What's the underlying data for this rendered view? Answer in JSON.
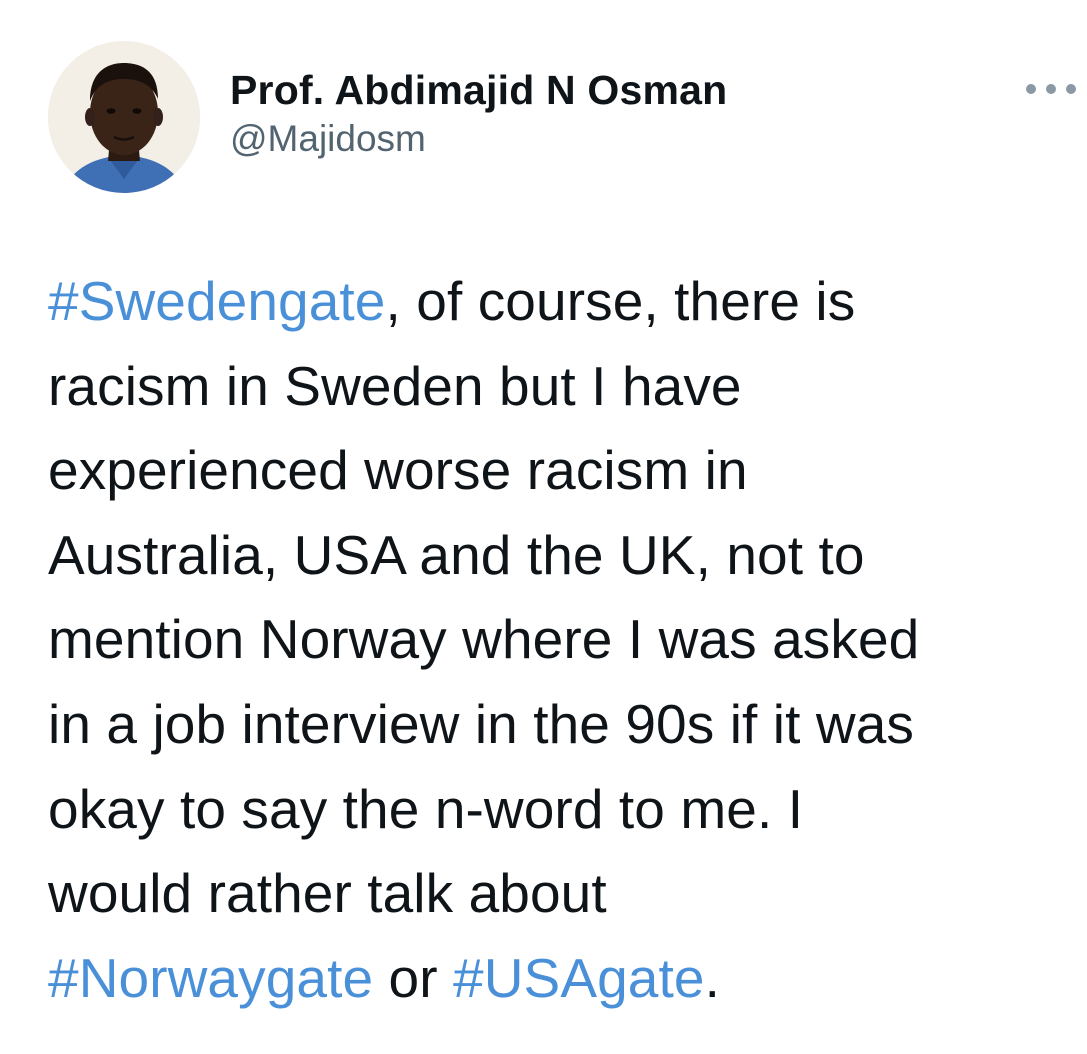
{
  "author": {
    "display_name": "Prof. Abdimajid N Osman",
    "handle": "@Majidosm",
    "avatar_icon": "profile-photo"
  },
  "more_icon": "more-options-icon",
  "tweet": {
    "line1": {
      "hashtag": "#Swedengate",
      "text": ", of course, there is"
    },
    "line2": "racism in Sweden but I have",
    "line3": "experienced worse racism in",
    "line4": "Australia, USA and the UK, not to",
    "line5": "mention Norway where I was asked",
    "line6": "in a job interview in the 90s if it was",
    "line7": "okay to say the n-word to me. I",
    "line8": "would rather talk about",
    "line9": {
      "hashtag1": "#Norwaygate",
      "connector": " or ",
      "hashtag2": "#USAgate",
      "end": "."
    }
  },
  "colors": {
    "hashtag": "#4a90d9",
    "text": "#0f1419",
    "handle": "#536471",
    "background": "#ffffff"
  }
}
